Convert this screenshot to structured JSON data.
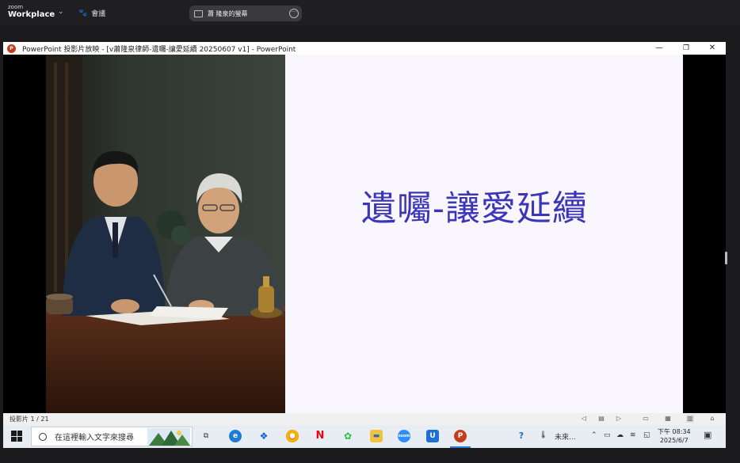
{
  "zoom": {
    "logo_top": "zoom",
    "logo_bottom": "Workplace",
    "meeting_label": "會議",
    "share_label": "蕭 隆泉的螢幕"
  },
  "window": {
    "title": "PowerPoint 投影片放映 - [v蕭隆泉律師-遺囑-讓愛延續 20250607 v1] - PowerPoint",
    "minimize": "—",
    "restore": "❐",
    "close": "✕"
  },
  "slide": {
    "title": "遺囑-讓愛延續"
  },
  "status": {
    "slide_counter": "投影片 1 / 21"
  },
  "taskbar": {
    "search_placeholder": "在這裡輸入文字來搜尋",
    "weather_text": "未來...",
    "time": "下午 08:34",
    "date": "2025/6/7"
  },
  "colors": {
    "slide_title": "#3b36b9",
    "slide_background": "#f9f6fd",
    "powerpoint_red": "#c43e1c"
  }
}
